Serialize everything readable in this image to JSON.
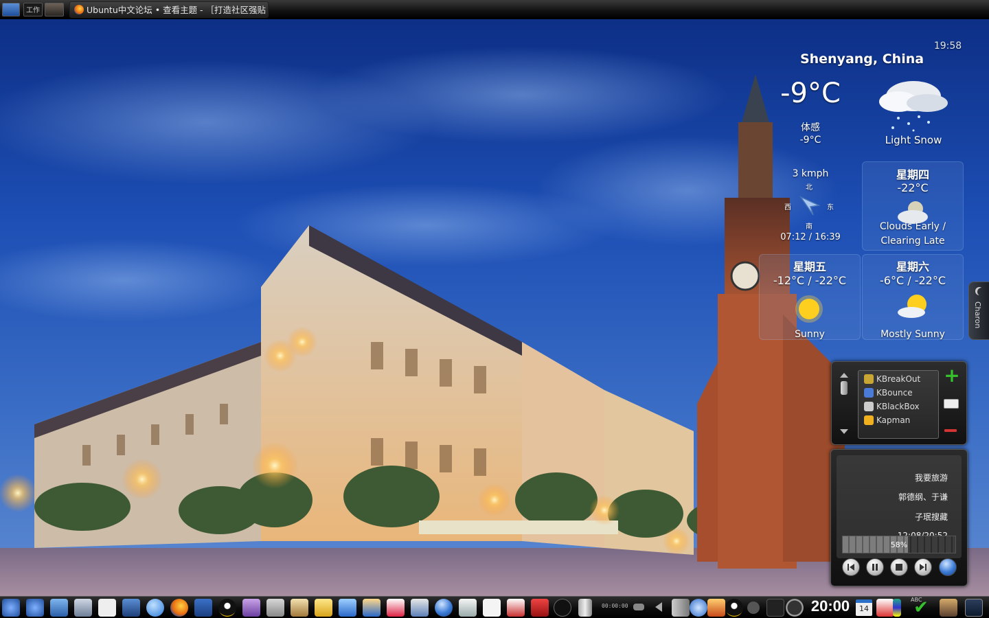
{
  "top_panel": {
    "pager_labels": [
      "",
      "工作",
      ""
    ],
    "task_title": "Ubuntu中文论坛 • 查看主题 - ［打造社区强贴 - 图"
  },
  "weather": {
    "clock": "19:58",
    "city": "Shenyang, China",
    "temperature": "-9°C",
    "feels_like_label": "体感",
    "feels_like_value": "-9°C",
    "condition": "Light Snow",
    "wind_speed": "3 kmph",
    "compass": {
      "north": "北",
      "west": "西",
      "east": "东",
      "south": "南"
    },
    "sunrise_sunset": "07:12 / 16:39",
    "forecast": [
      {
        "day": "星期四",
        "temp": "-22°C",
        "condition": "Clouds Early / Clearing Late",
        "icon": "cloud-moon-icon"
      },
      {
        "day": "星期五",
        "temp": "-12°C / -22°C",
        "condition": "Sunny",
        "icon": "sun-icon"
      },
      {
        "day": "星期六",
        "temp": "-6°C / -22°C",
        "condition": "Mostly Sunny",
        "icon": "partly-sunny-icon"
      }
    ]
  },
  "side_tab": {
    "label": "Charon"
  },
  "games": {
    "items": [
      {
        "label": "KBreakOut",
        "color": "#c9a634"
      },
      {
        "label": "KBounce",
        "color": "#4a7bd8"
      },
      {
        "label": "KBlackBox",
        "color": "#cccccc"
      },
      {
        "label": "Kapman",
        "color": "#f0b020"
      }
    ]
  },
  "player": {
    "title": "我要旅游",
    "artist": "郭德纲、于谦",
    "album": "子珉搜藏",
    "time": "12:08/20:52",
    "progress_percent": "58%",
    "progress_fraction": 0.58
  },
  "bottom_panel": {
    "clock": "20:00",
    "date": "14",
    "timer": "00:00:00",
    "lang": "ABC"
  },
  "colors": {
    "accent_green": "#35c12b",
    "remove_red": "#d33333",
    "calendar_blue": "#2a70c8"
  }
}
